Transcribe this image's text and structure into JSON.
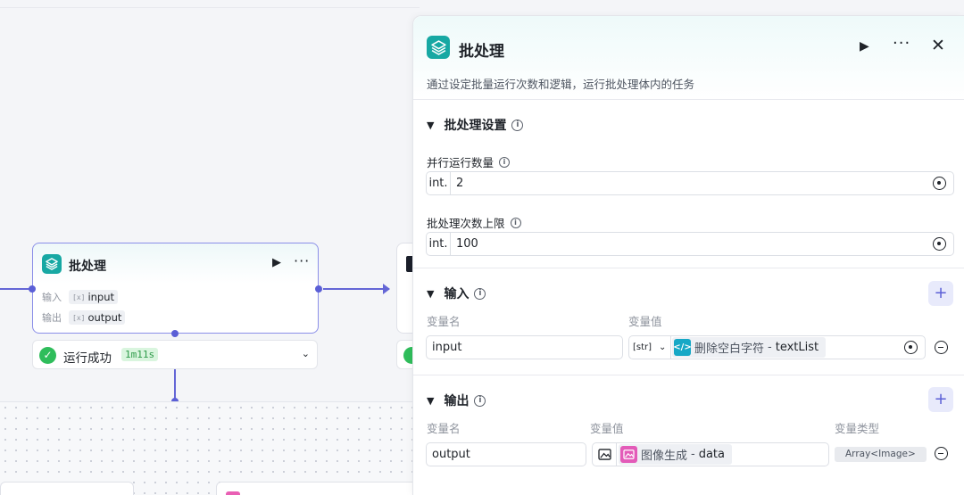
{
  "canvas": {
    "node": {
      "title": "批处理",
      "run_icon": "play-icon",
      "more_icon": "more-icon",
      "input_label": "输入",
      "input_value": "input",
      "output_label": "输出",
      "output_value": "output",
      "var_icon_glyph": "[x]"
    },
    "status": {
      "label": "运行成功",
      "time": "1m11s"
    }
  },
  "panel": {
    "title": "批处理",
    "description": "通过设定批量运行次数和逻辑，运行批处理体内的任务",
    "settings": {
      "title": "批处理设置",
      "parallel_label": "并行运行数量",
      "parallel_prefix": "int.",
      "parallel_value": "2",
      "limit_label": "批处理次数上限",
      "limit_prefix": "int.",
      "limit_value": "100"
    },
    "input": {
      "title": "输入",
      "col_name": "变量名",
      "col_value": "变量值",
      "row": {
        "name": "input",
        "type": "[str]",
        "ref_node": "删除空白字符",
        "ref_sep": "-",
        "ref_field": "textList"
      }
    },
    "output": {
      "title": "输出",
      "col_name": "变量名",
      "col_value": "变量值",
      "col_type": "变量类型",
      "row": {
        "name": "output",
        "ref_node": "图像生成",
        "ref_sep": "-",
        "ref_field": "data",
        "type": "Array<Image>"
      }
    }
  },
  "colors": {
    "accent": "#5b5fd6",
    "batch_icon": "#17a8a3",
    "success": "#2fbd5b",
    "image_badge": "#e35bb8",
    "code_badge": "#17a8c6"
  }
}
